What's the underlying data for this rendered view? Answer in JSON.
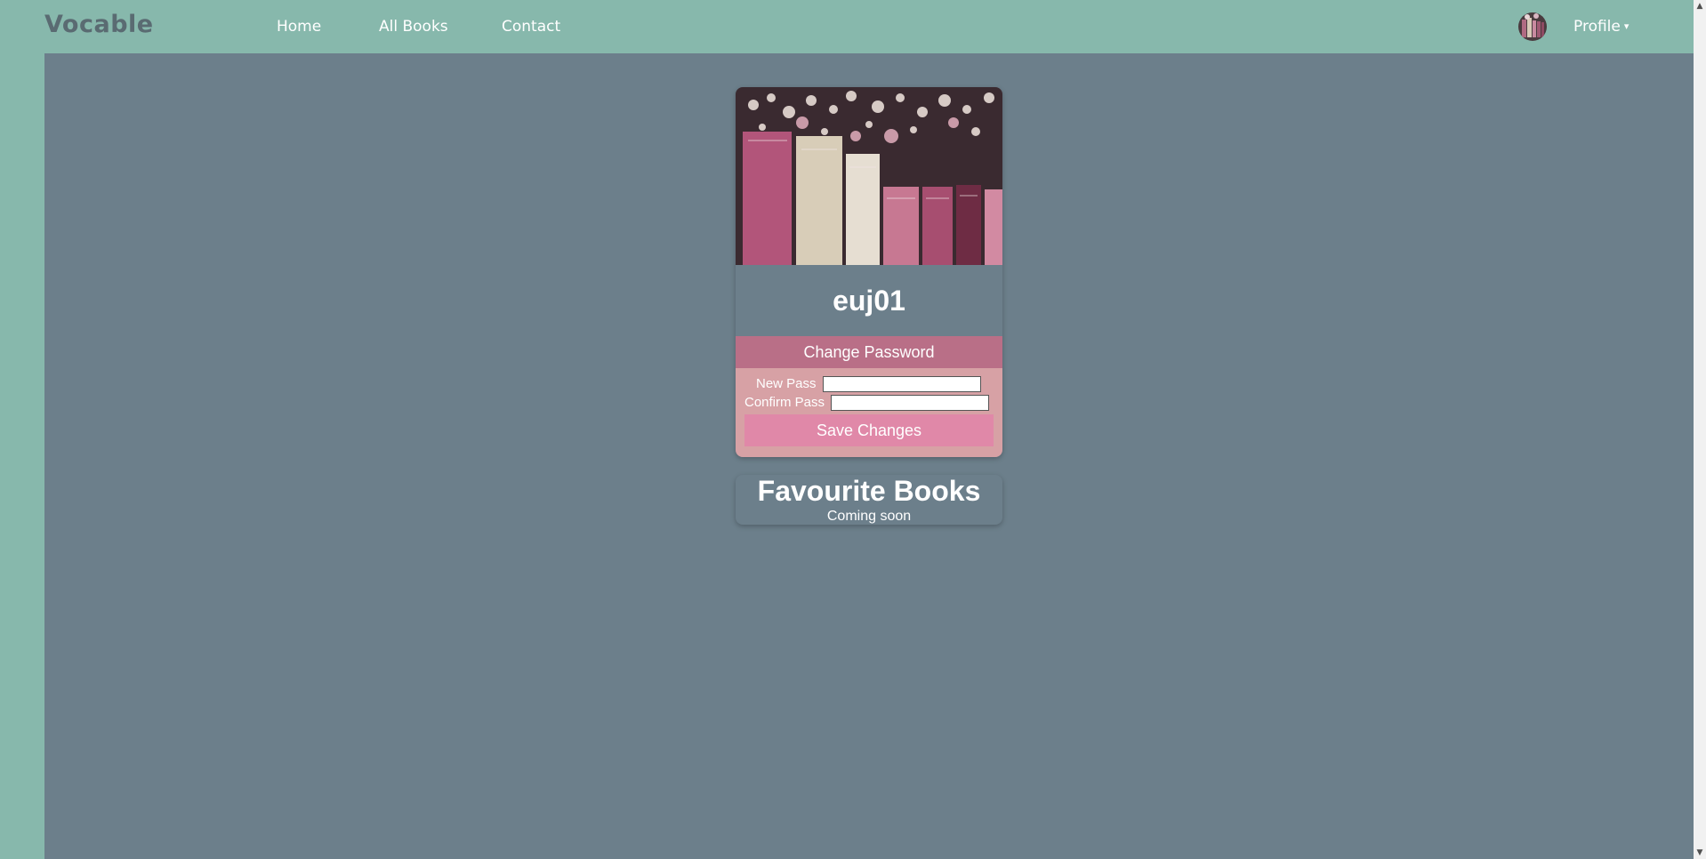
{
  "navbar": {
    "brand": "Vocable",
    "links": [
      "Home",
      "All Books",
      "Contact"
    ],
    "profile_label": "Profile",
    "caret": "▾"
  },
  "profile_card": {
    "username": "euj01",
    "change_password_header": "Change Password",
    "new_pass_label": "New Pass",
    "confirm_pass_label": "Confirm Pass",
    "new_pass_value": "",
    "confirm_pass_value": "",
    "save_label": "Save Changes"
  },
  "favourites": {
    "title": "Favourite Books",
    "subtitle": "Coming soon"
  },
  "colors": {
    "navbar_bg": "#87b8ac",
    "main_bg": "#6c7f8b",
    "change_pass_bg": "#b96f87",
    "form_bg": "#d7a1a5",
    "save_btn_bg": "#e088a8"
  },
  "icons": {
    "avatar": "avatar-image",
    "caret": "caret-down-icon",
    "cover": "books-cover-image"
  }
}
